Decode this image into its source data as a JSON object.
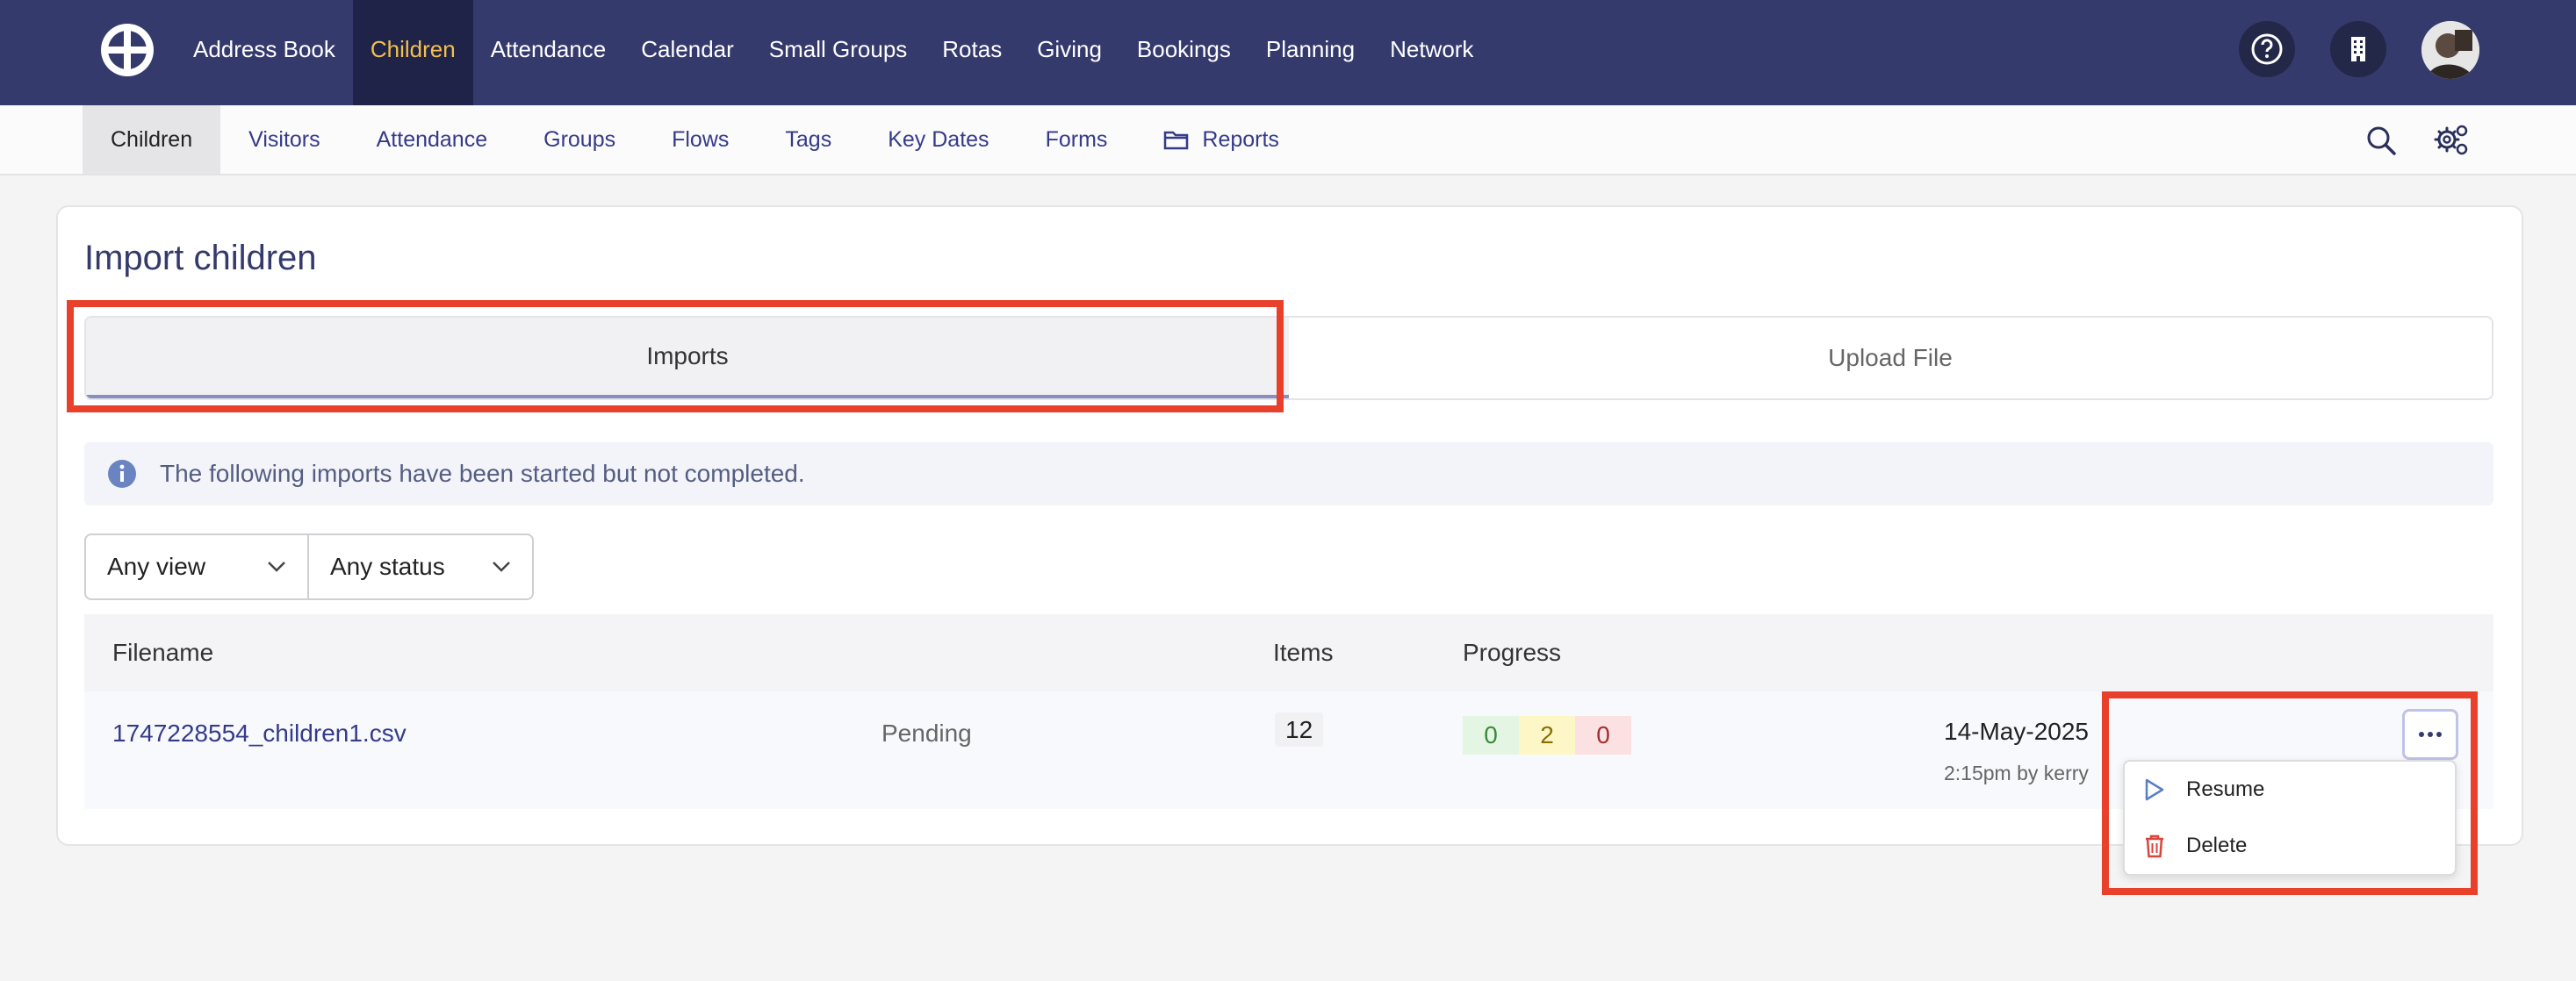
{
  "topnav": {
    "items": [
      {
        "label": "Address Book",
        "active": false
      },
      {
        "label": "Children",
        "active": true
      },
      {
        "label": "Attendance",
        "active": false
      },
      {
        "label": "Calendar",
        "active": false
      },
      {
        "label": "Small Groups",
        "active": false
      },
      {
        "label": "Rotas",
        "active": false
      },
      {
        "label": "Giving",
        "active": false
      },
      {
        "label": "Bookings",
        "active": false
      },
      {
        "label": "Planning",
        "active": false
      },
      {
        "label": "Network",
        "active": false
      }
    ],
    "icons": [
      "help-icon",
      "building-icon",
      "avatar"
    ]
  },
  "subnav": {
    "items": [
      {
        "label": "Children",
        "active": true
      },
      {
        "label": "Visitors"
      },
      {
        "label": "Attendance"
      },
      {
        "label": "Groups"
      },
      {
        "label": "Flows"
      },
      {
        "label": "Tags"
      },
      {
        "label": "Key Dates"
      },
      {
        "label": "Forms"
      },
      {
        "label": "Reports",
        "icon": "folder-icon"
      }
    ],
    "icons": [
      "search-icon",
      "settings-icon"
    ]
  },
  "page": {
    "title": "Import children",
    "tabs": [
      {
        "label": "Imports",
        "active": true
      },
      {
        "label": "Upload File",
        "active": false
      }
    ],
    "info_message": "The following imports have been started but not completed.",
    "filters": {
      "view": "Any view",
      "status": "Any status"
    }
  },
  "table": {
    "headers": {
      "filename": "Filename",
      "items": "Items",
      "progress": "Progress"
    },
    "rows": [
      {
        "filename": "1747228554_children1.csv",
        "status": "Pending",
        "items": "12",
        "progress": {
          "success": "0",
          "warning": "2",
          "error": "0"
        },
        "date": "14-May-2025",
        "time_user": "2:15pm by kerry"
      }
    ]
  },
  "row_menu": {
    "items": [
      {
        "label": "Resume",
        "icon": "play-icon"
      },
      {
        "label": "Delete",
        "icon": "trash-icon"
      }
    ]
  },
  "colors": {
    "nav_bg": "#353a6d",
    "nav_active_bg": "#1f2347",
    "nav_active_text": "#f2c14b",
    "link": "#353a8a",
    "highlight": "#e8402b",
    "success_bg": "#e4f5e4",
    "warning_bg": "#fdf7c8",
    "error_bg": "#fbe1e1"
  }
}
